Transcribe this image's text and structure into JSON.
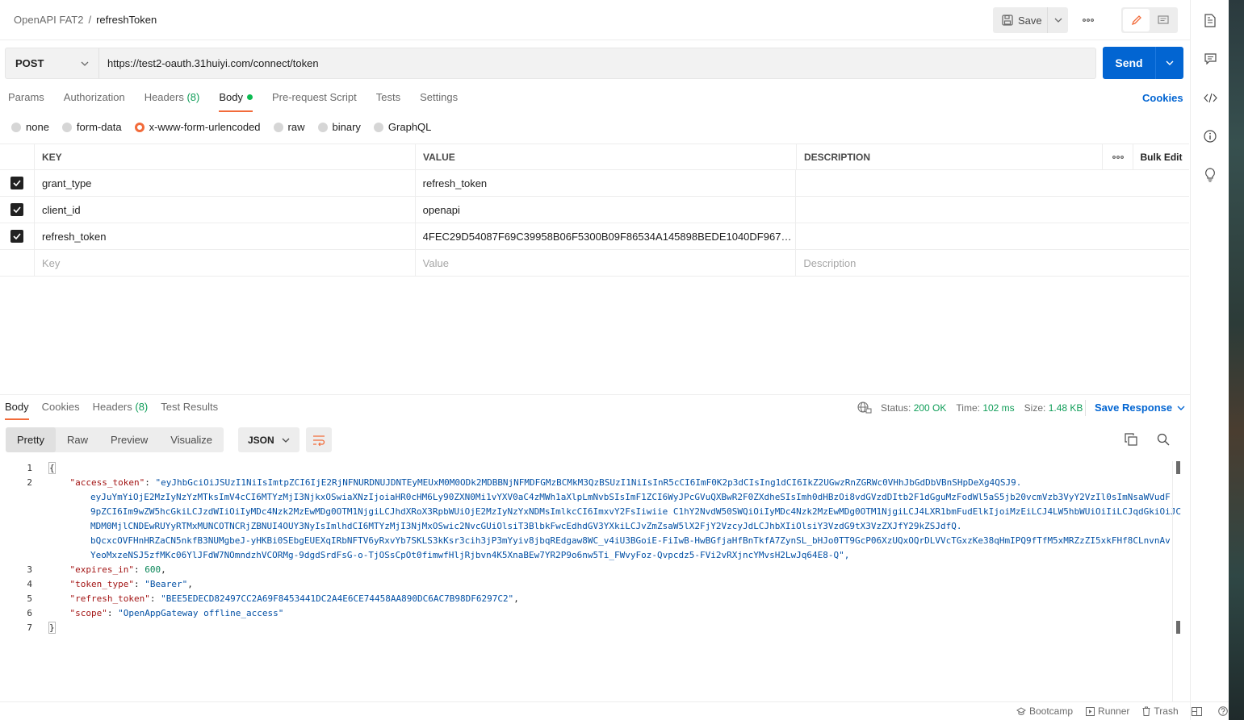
{
  "breadcrumb": {
    "parent": "OpenAPI FAT2",
    "separator": "/",
    "current": "refreshToken"
  },
  "header": {
    "save_label": "Save"
  },
  "request": {
    "method": "POST",
    "url": "https://test2-oauth.31huiyi.com/connect/token",
    "send_label": "Send"
  },
  "req_tabs": [
    {
      "label": "Params"
    },
    {
      "label": "Authorization"
    },
    {
      "label": "Headers",
      "count": "(8)"
    },
    {
      "label": "Body"
    },
    {
      "label": "Pre-request Script"
    },
    {
      "label": "Tests"
    },
    {
      "label": "Settings"
    }
  ],
  "cookies_label": "Cookies",
  "body_types": [
    "none",
    "form-data",
    "x-www-form-urlencoded",
    "raw",
    "binary",
    "GraphQL"
  ],
  "table": {
    "headers": {
      "key": "KEY",
      "value": "VALUE",
      "description": "DESCRIPTION",
      "bulk_edit": "Bulk Edit"
    },
    "rows": [
      {
        "key": "grant_type",
        "value": "refresh_token",
        "description": ""
      },
      {
        "key": "client_id",
        "value": "openapi",
        "description": ""
      },
      {
        "key": "refresh_token",
        "value": "4FEC29D54087F69C39958B06F5300B09F86534A145898BEDE1040DF9677B…",
        "description": ""
      }
    ],
    "placeholders": {
      "key": "Key",
      "value": "Value",
      "description": "Description"
    }
  },
  "response": {
    "tabs": [
      {
        "label": "Body"
      },
      {
        "label": "Cookies"
      },
      {
        "label": "Headers",
        "count": "(8)"
      },
      {
        "label": "Test Results"
      }
    ],
    "status_label": "Status:",
    "status_value": "200 OK",
    "time_label": "Time:",
    "time_value": "102 ms",
    "size_label": "Size:",
    "size_value": "1.48 KB",
    "save_response": "Save Response",
    "views": [
      "Pretty",
      "Raw",
      "Preview",
      "Visualize"
    ],
    "format": "JSON",
    "code": {
      "line_numbers": [
        "1",
        "2",
        "3",
        "4",
        "5",
        "6",
        "7"
      ],
      "access_token_key": "\"access_token\"",
      "access_token_lines": [
        "\"eyJhbGciOiJSUzI1NiIsImtpZCI6IjE2RjNFNURDNUJDNTEyMEUxM0M0ODk2MDBBNjNFMDFGMzBCMkM3QzBSUzI1NiIsInR5cCI6ImF0K2p3dCIsIng1dCI6IkZ2UGwzRnZGRWc0VHhJbGdDbVBnSHpDeXg4QSJ9.",
        "eyJuYmYiOjE2MzIyNzYzMTksImV4cCI6MTYzMjI3NjkxOSwiaXNzIjoiaHR0cHM6Ly90ZXN0Mi1vYXV0aC4zMWh1aXlpLmNvbSIsImF1ZCI6WyJPcGVuQXBwR2F0ZXdheSIsImh0dHBzOi8vdGVzdDItb2F1dGguMzFodWl5aS5jb20vcmVzb3VyY2VzIl0sImNsaWVudF",
        "9pZCI6Im9wZW5hcGkiLCJzdWIiOiIyMDc4Nzk2MzEwMDg0OTM1NjgiLCJhdXRoX3RpbWUiOjE2MzIyNzYxNDMsImlkcCI6ImxvY2FsIiwiie C1hY2NvdW50SWQiOiIyMDc4Nzk2MzEwMDg0OTM1NjgiLCJ4LXR1bmFudElkIjoiMzEiLCJ4LW5hbWUiOiIiLCJqdGkiOiJC",
        "MDM0MjlCNDEwRUYyRTMxMUNCOTNCRjZBNUI4OUY3NyIsImlhdCI6MTYzMjI3NjMxOSwic2NvcGUiOlsiT3BlbkFwcEdhdGV3YXkiLCJvZmZsaW5lX2FjY2VzcyJdLCJhbXIiOlsiY3VzdG9tX3VzZXJfY29kZSJdfQ.",
        "bQcxcOVFHnHRZaCN5nkfB3NUMgbeJ-yHKBi0SEbgEUEXqIRbNFTV6yRxvYb7SKLS3kKsr3cih3jP3mYyiv8jbqREdgaw8WC_v4iU3BGoiE-FiIwB-HwBGfjaHfBnTkfA7ZynSL_bHJo0TT9GcP06XzUQxOQrDLVVcTGxzKe38qHmIPQ9fTfM5xMRZzZI5xkFHf8CLnvnAv",
        "YeoMxzeNSJ5zfMKc06YlJFdW7NOmndzhVCORMg-9dgdSrdFsG-o-TjOSsCpOt0fimwfHljRjbvn4K5XnaBEw7YR2P9o6nw5Ti_FWvyFoz-Qvpcdz5-FVi2vRXjncYMvsH2LwJq64E8-Q\","
      ],
      "expires_key": "\"expires_in\"",
      "expires_value": "600",
      "token_type_key": "\"token_type\"",
      "token_type_value": "\"Bearer\"",
      "refresh_key": "\"refresh_token\"",
      "refresh_value": "\"BEE5EDECD82497CC2A69F8453441DC2A4E6CE74458AA890DC6AC7B98DF6297C2\"",
      "scope_key": "\"scope\"",
      "scope_value": "\"OpenAppGateway offline_access\""
    }
  },
  "footer": {
    "bootcamp": "Bootcamp",
    "runner": "Runner",
    "trash": "Trash"
  },
  "icons": {
    "save": "floppy-disk-icon",
    "more": "ellipsis-icon",
    "edit": "pencil-icon",
    "comment": "comment-icon",
    "documentation": "document-icon",
    "comments": "chat-icon",
    "code": "code-icon",
    "info": "info-icon",
    "lightbulb": "lightbulb-icon"
  },
  "colors": {
    "accent": "#f26b3a",
    "send": "#0265d2",
    "success": "#0f9d58"
  }
}
